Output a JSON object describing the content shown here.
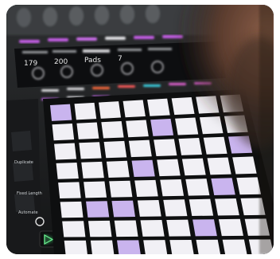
{
  "device": {
    "display_values": [
      "179",
      "200",
      "Pads",
      "7"
    ],
    "side_buttons": [
      "Duplicate",
      "Fixed Length",
      "Automate"
    ],
    "grid": {
      "rows": 8,
      "cols": 8
    }
  },
  "colors": {
    "background": "#ffffff",
    "pad_white": "#f1f0f5",
    "pad_lavender": "#c9b4ee",
    "hand": "#6b4a3a",
    "play_green": "#3ec26a",
    "device_body": "#1a1c1e"
  }
}
